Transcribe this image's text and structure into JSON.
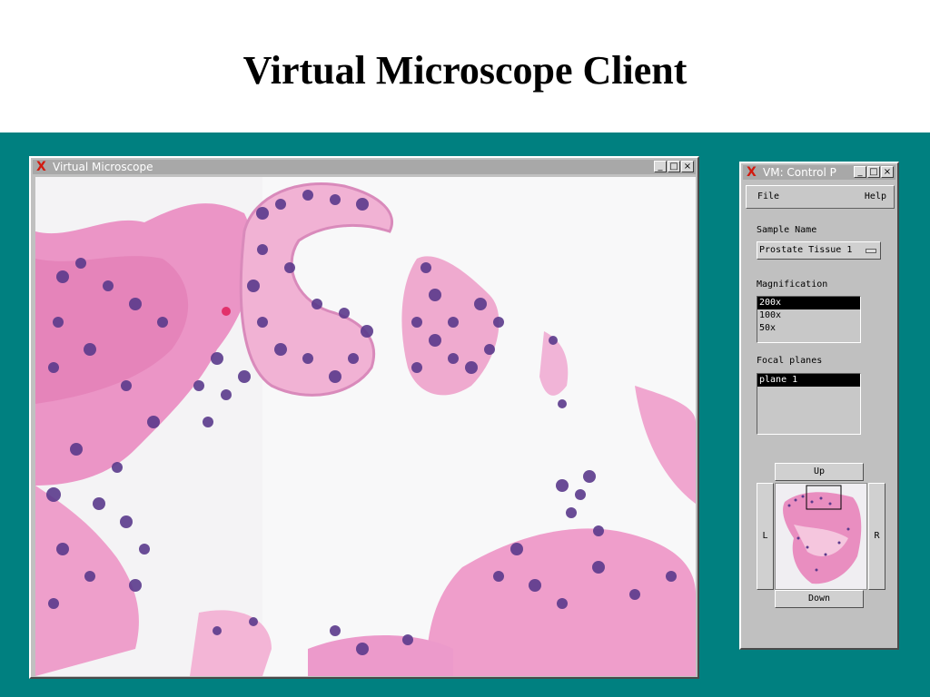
{
  "slide": {
    "title": "Virtual Microscope Client"
  },
  "colors": {
    "background": "#008080",
    "selection": "#000000",
    "tissue_pink": "#e98ec0",
    "nuclei_purple": "#5b3a8c"
  },
  "viewer_window": {
    "title": "Virtual Microscope",
    "logo": "X",
    "buttons": {
      "minimize": "_",
      "maximize": "□",
      "close": "×"
    },
    "image_description_icon": "histology-image"
  },
  "control_panel": {
    "title": "VM: Control P",
    "logo": "X",
    "buttons": {
      "minimize": "_",
      "maximize": "□",
      "close": "×"
    },
    "menu": {
      "file": "File",
      "help": "Help"
    },
    "sample_label": "Sample Name",
    "sample_value": "Prostate Tissue 1",
    "magnification_label": "Magnification",
    "magnifications": [
      "200x",
      "100x",
      "50x"
    ],
    "selected_magnification": "200x",
    "focal_label": "Focal planes",
    "focal_planes": [
      "plane 1"
    ],
    "selected_focal_plane": "plane 1",
    "nav": {
      "up": "Up",
      "down": "Down",
      "left": "L",
      "right": "R"
    }
  }
}
